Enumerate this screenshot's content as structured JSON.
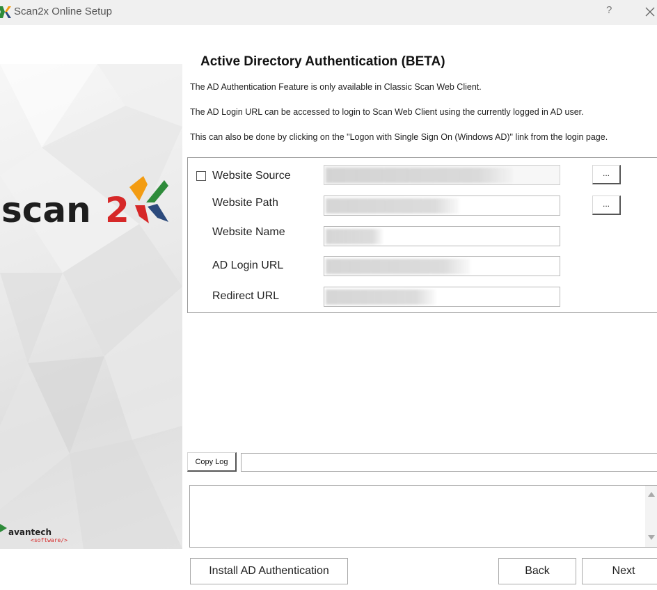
{
  "window": {
    "title": "Scan2x Online Setup",
    "help_label": "?"
  },
  "branding": {
    "logo_text": "scan2",
    "vendor_name": "avantech",
    "vendor_tagline": "<software/>",
    "colors": {
      "logo_text": "#1e1e1e",
      "red": "#d62828",
      "orange": "#f39c12",
      "green": "#2e8b3a",
      "blue": "#2c4a7c"
    }
  },
  "page": {
    "heading": "Active Directory Authentication (BETA)",
    "info_lines": [
      "The AD Authentication Feature is only available in Classic Scan Web Client.",
      "The AD Login URL can be accessed to login to Scan Web Client using the currently logged in AD user.",
      "This can also be done by clicking on the \"Logon with Single Sign On (Windows AD)\" link from the login page."
    ]
  },
  "form": {
    "website_source": {
      "label": "Website Source",
      "checked": false
    },
    "website_path": {
      "label": "Website Path"
    },
    "website_name": {
      "label": "Website Name"
    },
    "ad_login_url": {
      "label": "AD Login URL"
    },
    "redirect_url": {
      "label": "Redirect URL"
    },
    "browse_label": "..."
  },
  "log": {
    "copy_log_label": "Copy Log"
  },
  "footer": {
    "install_label": "Install AD Authentication",
    "back_label": "Back",
    "next_label": "Next"
  }
}
